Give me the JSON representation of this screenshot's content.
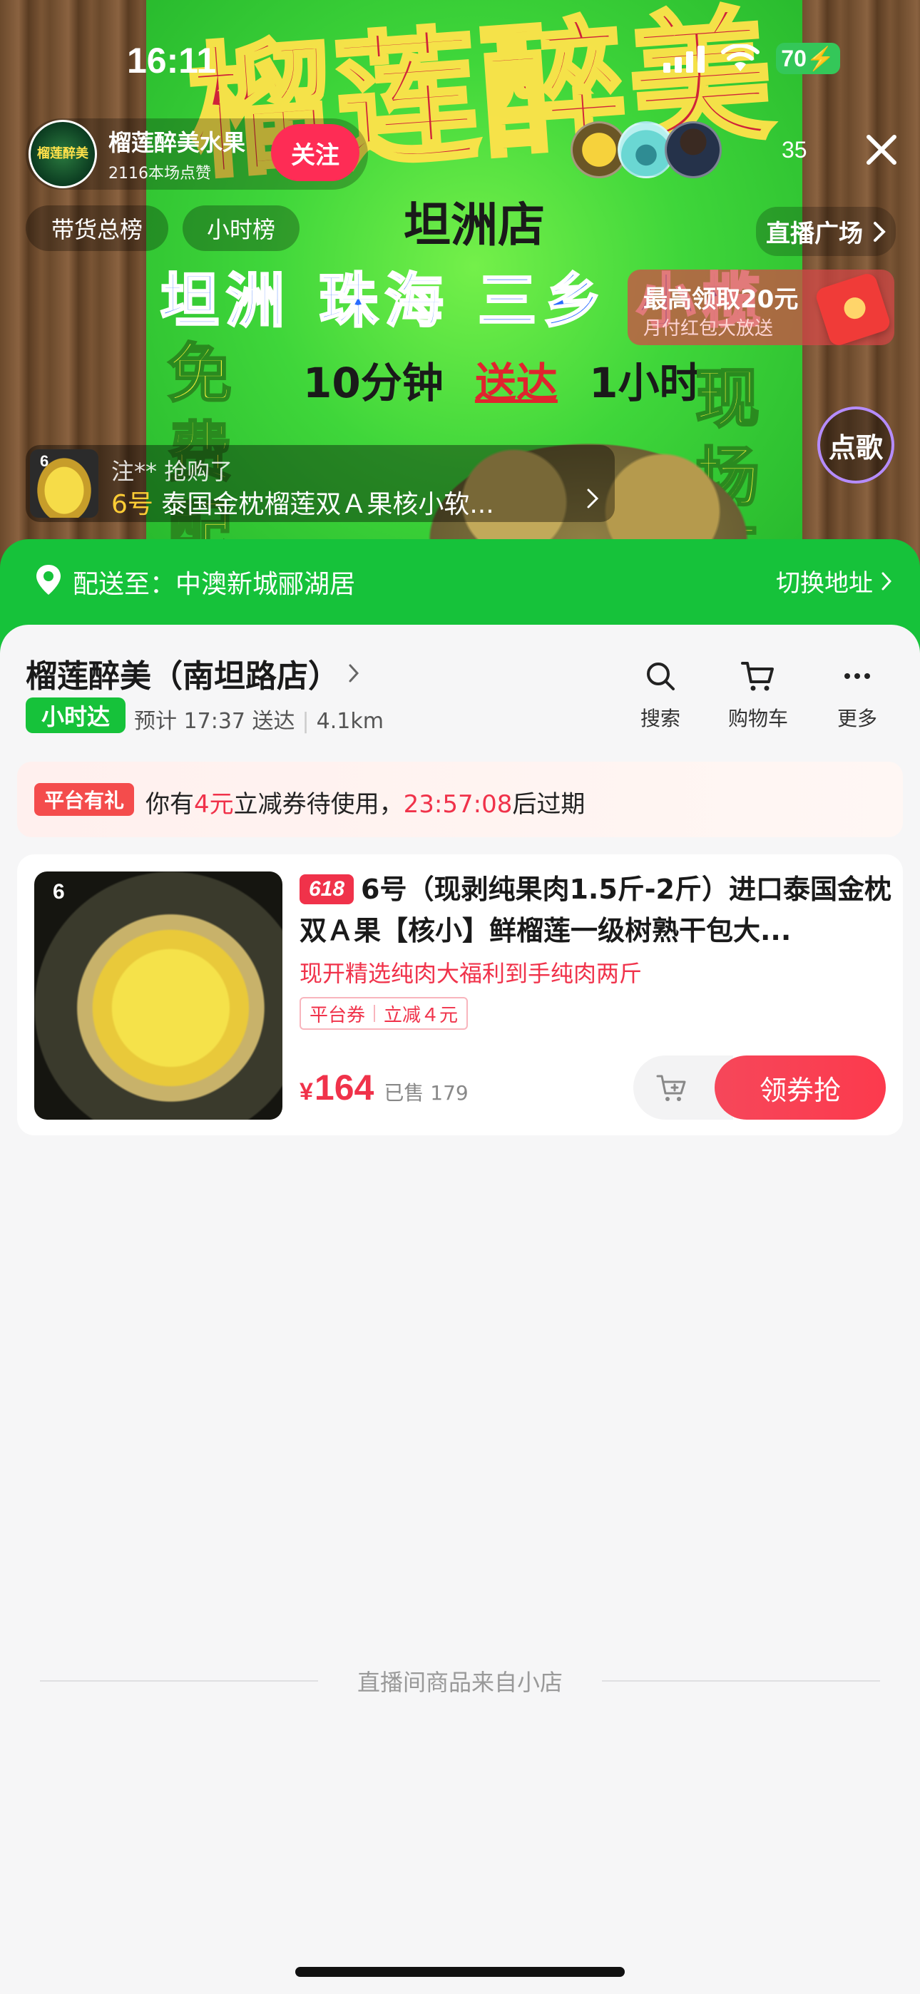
{
  "status_bar": {
    "time": "16:11",
    "battery": "70"
  },
  "host": {
    "avatar_text": "榴莲醉美",
    "name": "榴莲醉美水果",
    "likes": "2116本场点赞",
    "follow_label": "关注"
  },
  "viewers": {
    "count": "35"
  },
  "chips": {
    "sales_rank": "带货总榜",
    "hour_rank": "小时榜",
    "plaza": "直播广场"
  },
  "stream_banner": {
    "big_title": "榴莲醉美",
    "shop": "坦洲店",
    "areas": "坦洲 珠海 三乡 小榄",
    "time_a": "10分钟",
    "time_mid": "送达",
    "time_b": "1小时",
    "side_left": "免费配",
    "side_right": "现场开"
  },
  "red_packet": {
    "title": "最高领取20元",
    "subtitle": "月付红包大放送"
  },
  "song_button": "点歌",
  "ticker": {
    "thumb_number": "6",
    "user": "注** 抢购了",
    "item_number": "6号",
    "item_text": "泰国金枕榴莲双Ａ果核小软..."
  },
  "address": {
    "label": "配送至：",
    "value": "中澳新城郦湖居",
    "switch_label": "切换地址"
  },
  "store": {
    "name": "榴莲醉美（南坦路店）",
    "tag": "小时达",
    "eta": "预计 17:37 送达",
    "distance": "4.1km"
  },
  "tools": {
    "search": "搜索",
    "cart": "购物车",
    "more": "更多"
  },
  "promo": {
    "tag": "平台有礼",
    "pre": "你有",
    "amount": "4元",
    "mid": "立减券待使用，",
    "countdown": "23:57:08",
    "post": "后过期"
  },
  "product": {
    "image_number": "6",
    "badge": "618",
    "title": "6号（现剥纯果肉1.5斤-2斤）进口泰国金枕双Ａ果【核小】鲜榴莲一级树熟干包大...",
    "subtitle": "现开精选纯肉大福利到手纯肉两斤",
    "coupon_a": "平台券",
    "coupon_b": "立减４元",
    "price_symbol": "¥",
    "price": "164",
    "sold": "已售 179",
    "buy_label": "领券抢"
  },
  "footer_note": "直播间商品来自小店",
  "colors": {
    "brand_green": "#16c23a",
    "accent_red": "#f0324a",
    "follow_pink": "#fe2c55"
  }
}
